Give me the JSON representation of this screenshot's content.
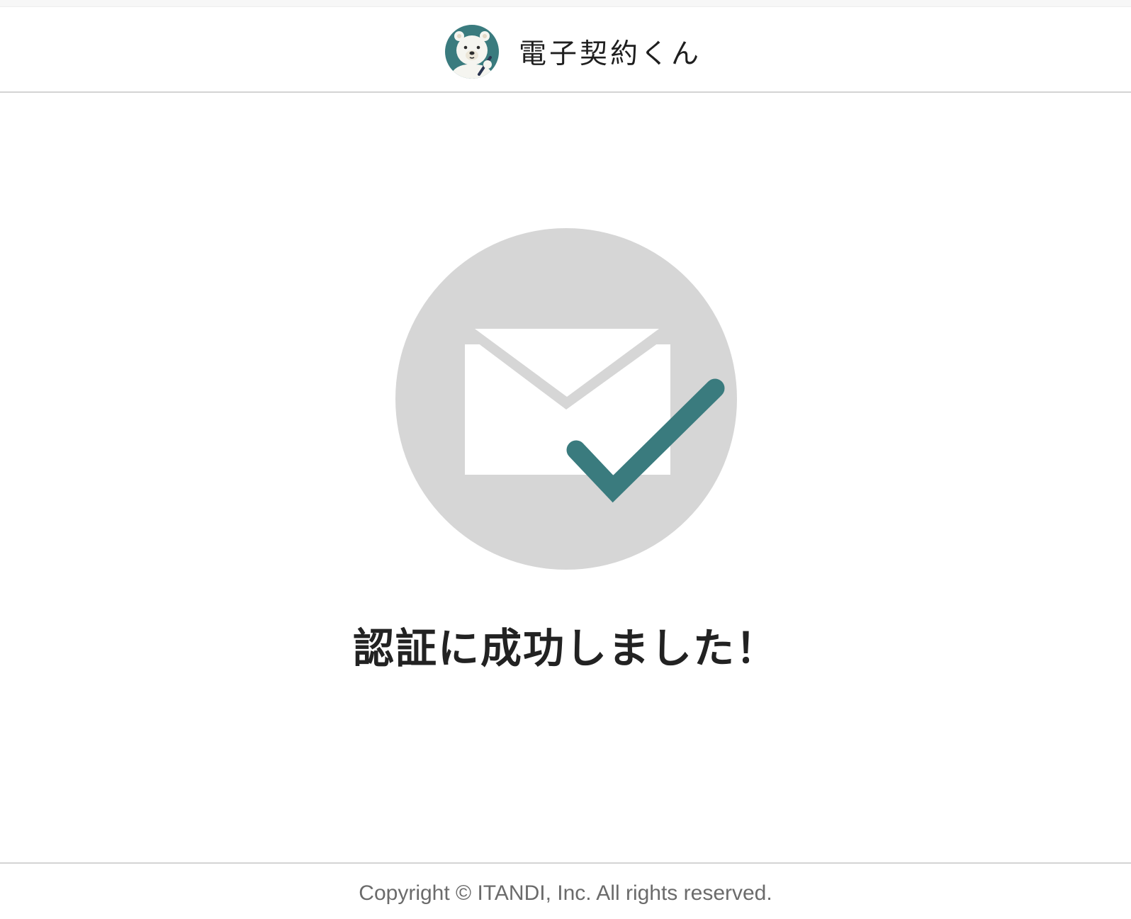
{
  "header": {
    "app_name": "電子契約くん",
    "logo_icon": "polar-bear-mascot-icon"
  },
  "main": {
    "status_icon": "mail-verified-icon",
    "message": "認証に成功しました！"
  },
  "footer": {
    "copyright": "Copyright © ITANDI, Inc. All rights reserved."
  },
  "colors": {
    "brand_teal": "#3a7b7e",
    "circle_gray": "#d6d6d6",
    "text": "#222222",
    "footer_text": "#6b6b6b"
  }
}
